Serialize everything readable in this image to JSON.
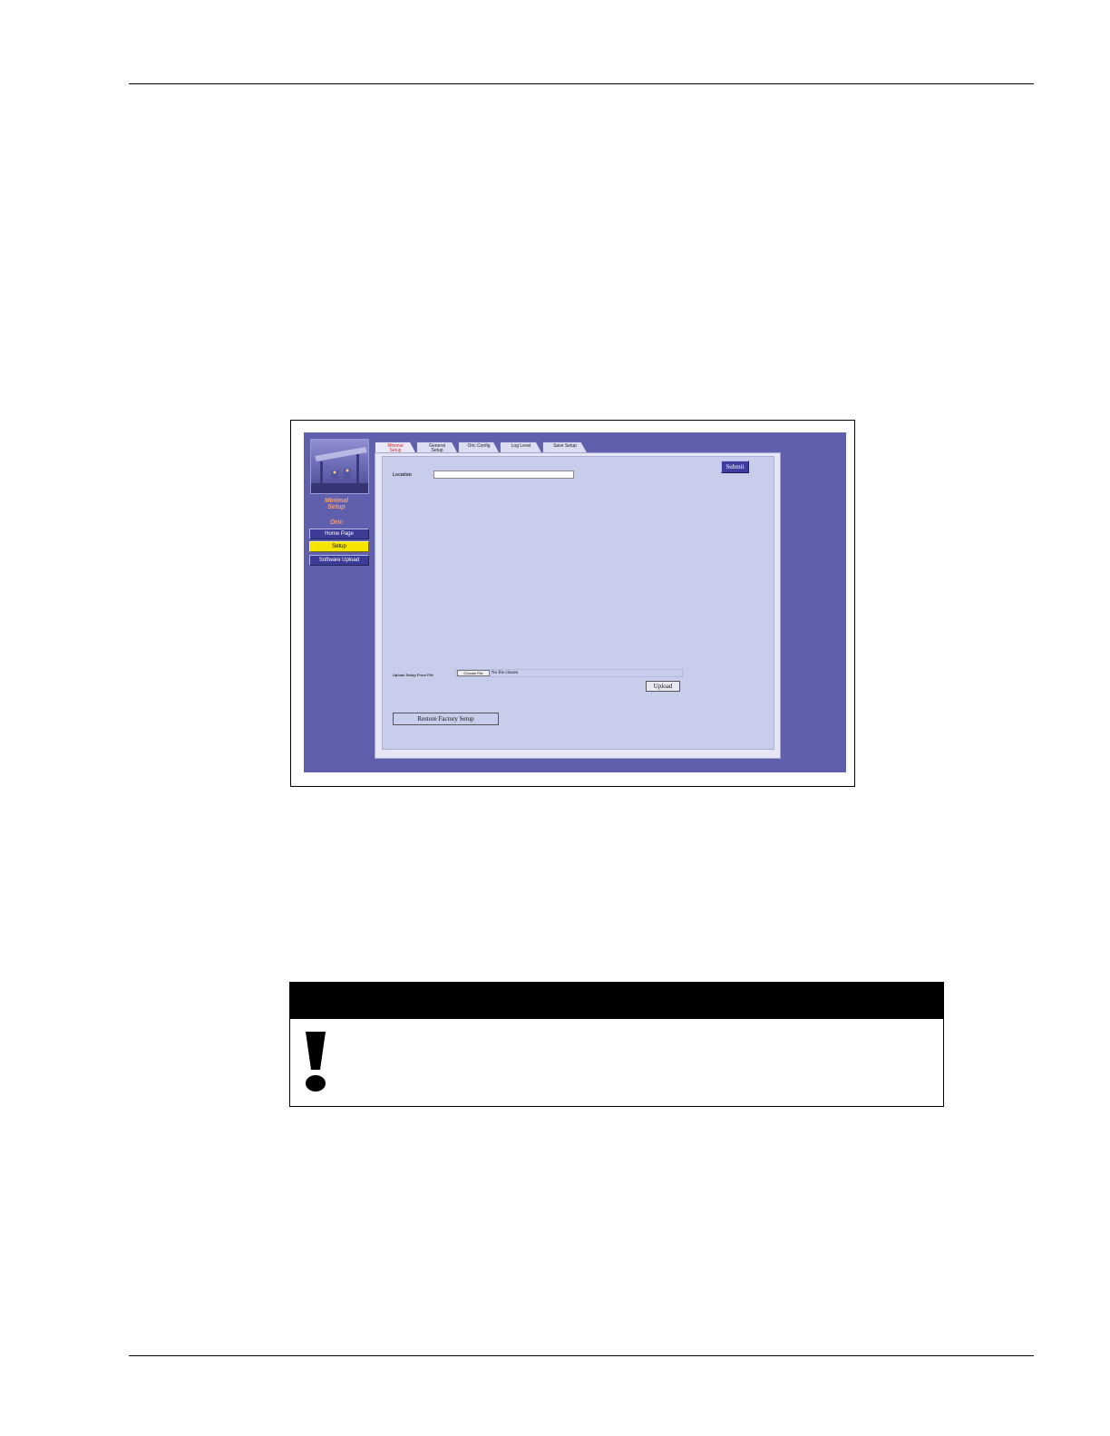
{
  "screenshot": {
    "sidebar": {
      "title": "Minimal\nSetup",
      "subtitle": "Oric",
      "nav": {
        "home": "Home Page",
        "setup": "Setup",
        "software_upload": "Software Upload"
      }
    },
    "tabs": {
      "minimal_setup": "Minimal\nSetup",
      "general_setup": "General\nSetup",
      "oric_config": "Oric Config",
      "log_level": "Log Level",
      "save_setup": "Save Setup"
    },
    "form": {
      "location_label": "Location",
      "location_value": "",
      "submit_label": "Submit",
      "upload_label": "Upload Setup From File",
      "choose_file_label": "Choose File",
      "no_file_text": "No file chosen",
      "upload_button_label": "Upload",
      "restore_button_label": "Restore Factory Setup"
    },
    "icons": {
      "logo": "gas-station-image"
    }
  },
  "caution": {
    "icon": "exclamation-icon"
  }
}
